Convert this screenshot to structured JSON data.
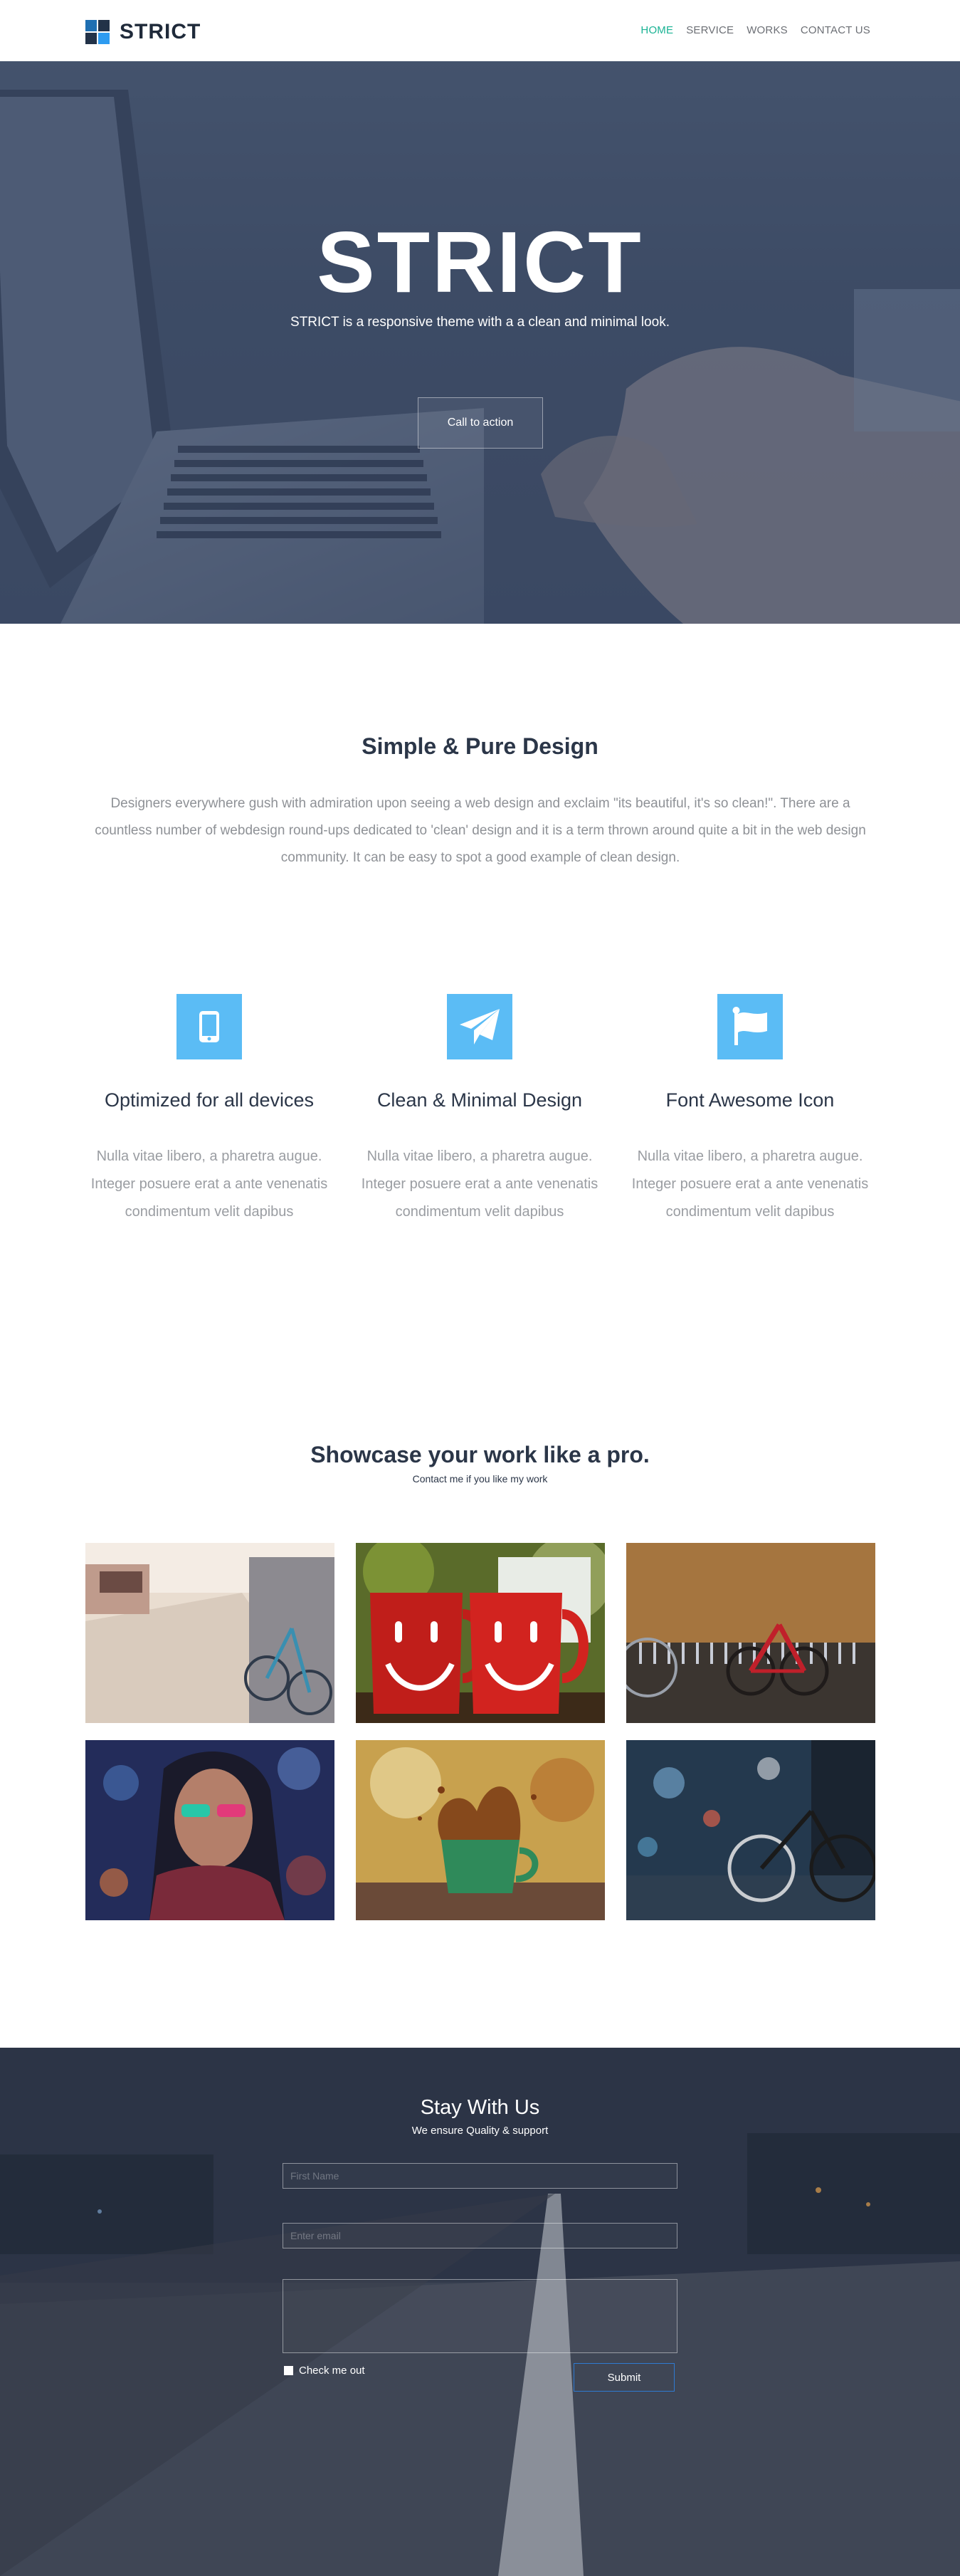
{
  "nav": {
    "brand": "STRICT",
    "items": [
      {
        "label": "HOME",
        "active": true
      },
      {
        "label": "SERVICE",
        "active": false
      },
      {
        "label": "WORKS",
        "active": false
      },
      {
        "label": "CONTACT US",
        "active": false
      }
    ]
  },
  "hero": {
    "title": "STRICT",
    "subtitle": "STRICT is a responsive theme with a a clean and minimal look.",
    "cta": "Call to action"
  },
  "intro": {
    "title": "Simple & Pure Design",
    "text": "Designers everywhere gush with admiration upon seeing a web design and exclaim \"its beautiful, it's so clean!\". There are a countless number of webdesign round-ups dedicated to 'clean' design and it is a term thrown around quite a bit in the web design community. It can be easy to spot a good example of clean design."
  },
  "features": [
    {
      "icon": "mobile-icon",
      "title": "Optimized for all devices",
      "text": "Nulla vitae libero, a pharetra augue. Integer posuere erat a ante venenatis condimentum velit dapibus"
    },
    {
      "icon": "paper-plane-icon",
      "title": "Clean & Minimal Design",
      "text": "Nulla vitae libero, a pharetra augue. Integer posuere erat a ante venenatis condimentum velit dapibus"
    },
    {
      "icon": "flag-icon",
      "title": "Font Awesome Icon",
      "text": "Nulla vitae libero, a pharetra augue. Integer posuere erat a ante venenatis condimentum velit dapibus"
    }
  ],
  "showcase": {
    "title": "Showcase your work like a pro.",
    "subtitle": "Contact me if you like my work",
    "items": [
      "street-bicycle-photo",
      "smiley-mugs-photo",
      "red-bicycle-photo",
      "woman-sunglasses-photo",
      "coffee-splash-photo",
      "bicycle-bokeh-photo"
    ]
  },
  "contact": {
    "title": "Stay With Us",
    "subtitle": "We ensure Quality & support",
    "first_name_placeholder": "First Name",
    "email_placeholder": "Enter email",
    "message_placeholder": "",
    "checkbox_label": "Check me out",
    "submit_label": "Submit"
  },
  "colors": {
    "accent": "#1ab394",
    "feature_icon_bg": "#5bbcf5",
    "submit_border": "#2e7ad1"
  }
}
